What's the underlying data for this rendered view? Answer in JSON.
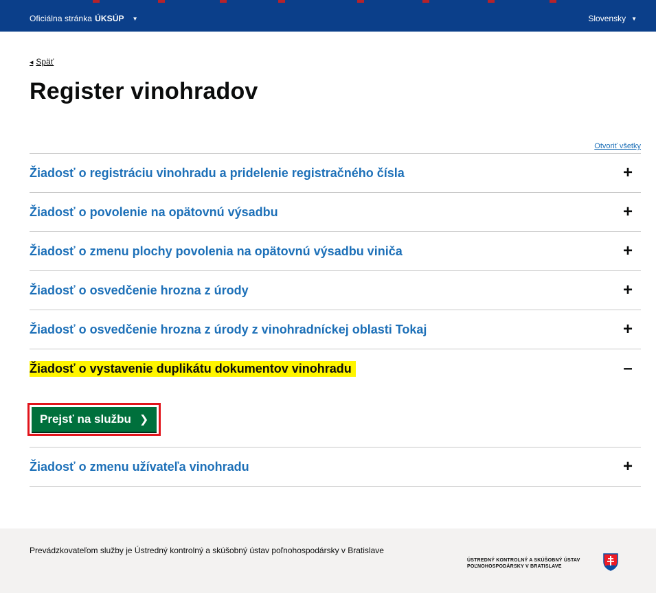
{
  "header": {
    "official_prefix": "Oficiálna stránka",
    "official_org": "ÚKSÚP",
    "language": "Slovensky"
  },
  "nav": {
    "back_label": "Späť"
  },
  "page": {
    "title": "Register vinohradov",
    "open_all": "Otvoriť všetky"
  },
  "sections": [
    {
      "title": "Žiadosť o registráciu vinohradu a pridelenie registračného čísla",
      "sign": "+"
    },
    {
      "title": "Žiadosť o povolenie na opätovnú výsadbu",
      "sign": "+"
    },
    {
      "title": "Žiadosť o zmenu plochy povolenia na opätovnú výsadbu viniča",
      "sign": "+"
    },
    {
      "title": "Žiadosť o osvedčenie hrozna z úrody",
      "sign": "+"
    },
    {
      "title": "Žiadosť o osvedčenie hrozna z úrody z vinohradníckej oblasti Tokaj",
      "sign": "+"
    },
    {
      "title": "Žiadosť o vystavenie duplikátu dokumentov vinohradu",
      "sign": "–",
      "button": "Prejsť na službu"
    },
    {
      "title": "Žiadosť o zmenu užívateľa vinohradu",
      "sign": "+"
    }
  ],
  "footer": {
    "text": "Prevádzkovateľom služby je Ústredný kontrolný a skúšobný ústav poľnohospodársky v Bratislave",
    "logo_line1": "ÚSTREDNÝ KONTROLNÝ A SKÚŠOBNÝ ÚSTAV",
    "logo_line2": "POĽNOHOSPODÁRSKY V BRATISLAVE"
  },
  "colors": {
    "header_bg": "#0b3f8a",
    "link_blue": "#1d70b8",
    "button_green": "#00703c",
    "highlight_yellow": "#fff500",
    "focus_red": "#e1141b"
  }
}
